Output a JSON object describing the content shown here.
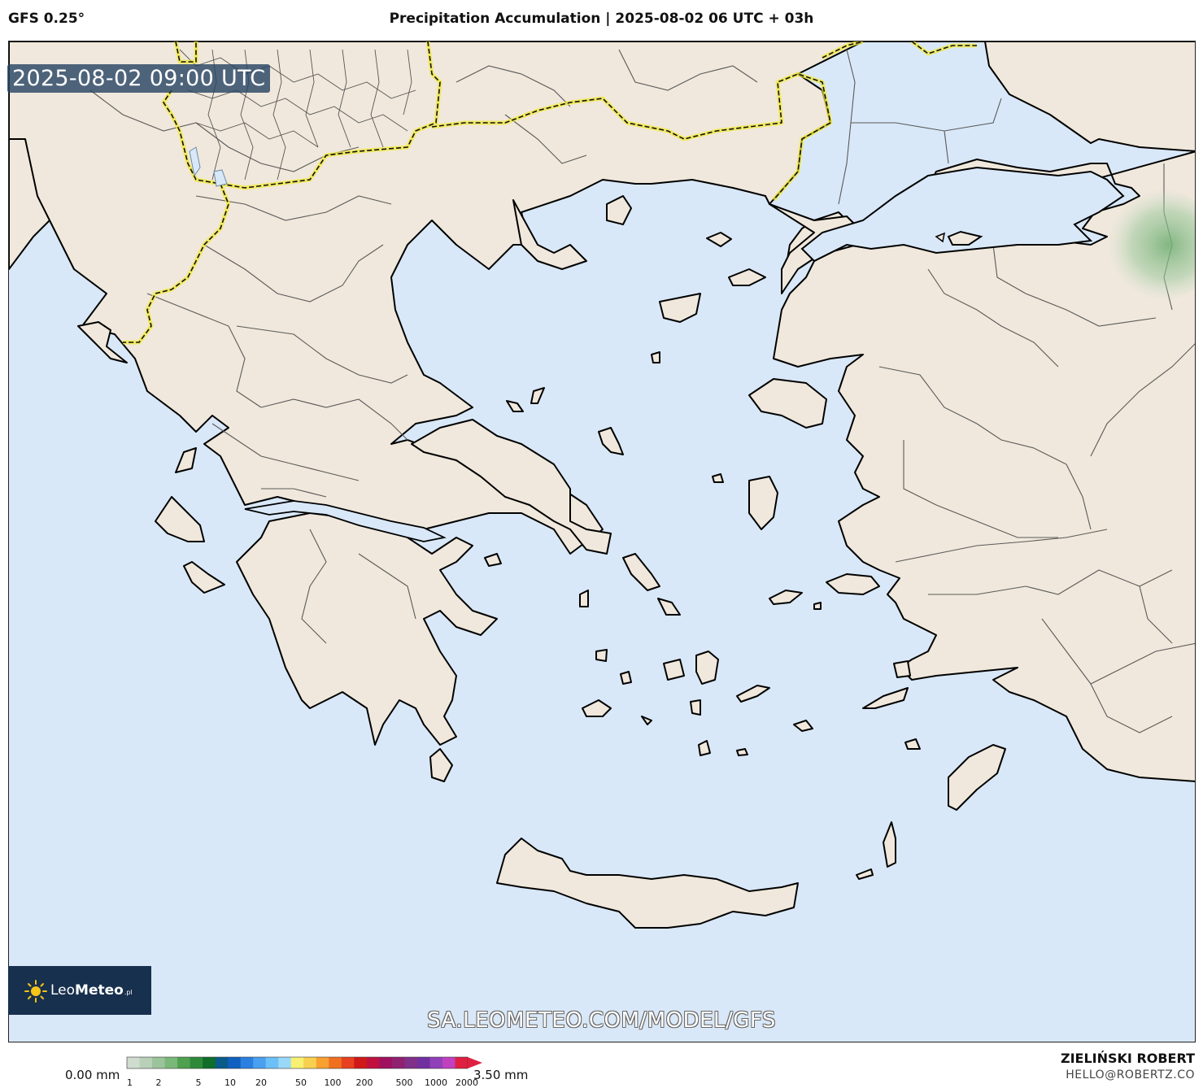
{
  "header": {
    "model": "GFS 0.25°",
    "title": "Precipitation Accumulation | 2025-08-02 06 UTC + 03h"
  },
  "map": {
    "valid_time": "2025-08-02 09:00 UTC",
    "region": "Greece / Aegean Sea",
    "colors": {
      "sea": "#d9e8f8",
      "land": "#f0e8dc",
      "coast": "#000000",
      "admin_border": "#555555",
      "country_border_highlight": "#f2ea3a",
      "precip_light": "#8fc08f"
    }
  },
  "logo": {
    "name": "LeoMeteo",
    "name_prefix": "Leo",
    "name_suffix": "Meteo",
    "tld": ".pl",
    "icon": "sun-icon"
  },
  "watermark": {
    "url": "SA.LEOMETEO.COM/MODEL/GFS"
  },
  "colorbar": {
    "min_label": "0.00 mm",
    "max_label": "3.50 mm",
    "ticks": [
      "1",
      "2",
      "5",
      "10",
      "20",
      "50",
      "100",
      "200",
      "500",
      "1000",
      "2000"
    ],
    "colors": [
      "#d0dcd0",
      "#b8d0b8",
      "#9cc49c",
      "#7ab87a",
      "#4fa04f",
      "#2e8a3a",
      "#0f6e2a",
      "#0a5a8a",
      "#1060c0",
      "#2a7fe0",
      "#4aa0f0",
      "#6cc0f8",
      "#9ad8f8",
      "#f8f070",
      "#f8d050",
      "#f8a030",
      "#f07020",
      "#e84020",
      "#d01818",
      "#c01040",
      "#a01060",
      "#902070",
      "#803088",
      "#7030a0",
      "#9040b8",
      "#c040c0",
      "#e02040"
    ]
  },
  "credit": {
    "name": "ZIELIŃSKI ROBERT",
    "email": "HELLO@ROBERTZ.CO"
  }
}
